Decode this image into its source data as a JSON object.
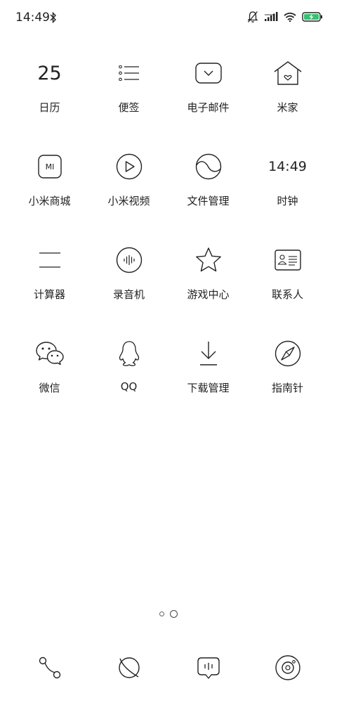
{
  "status_bar": {
    "time": "14:49",
    "icons": [
      "bluetooth-icon",
      "mute-icon",
      "signal-icon",
      "wifi-icon",
      "battery-charging-icon"
    ],
    "battery_color": "#38c172"
  },
  "calendar": {
    "day": "25"
  },
  "clock": {
    "time": "14:49"
  },
  "mi_badge": "MI",
  "apps": [
    {
      "label": "日历",
      "icon": "calendar-icon"
    },
    {
      "label": "便签",
      "icon": "notes-icon"
    },
    {
      "label": "电子邮件",
      "icon": "email-icon"
    },
    {
      "label": "米家",
      "icon": "home-icon"
    },
    {
      "label": "小米商城",
      "icon": "mi-store-icon"
    },
    {
      "label": "小米视频",
      "icon": "video-icon"
    },
    {
      "label": "文件管理",
      "icon": "file-manager-icon"
    },
    {
      "label": "时钟",
      "icon": "clock-icon"
    },
    {
      "label": "计算器",
      "icon": "calculator-icon"
    },
    {
      "label": "录音机",
      "icon": "recorder-icon"
    },
    {
      "label": "游戏中心",
      "icon": "star-icon"
    },
    {
      "label": "联系人",
      "icon": "contacts-icon"
    },
    {
      "label": "微信",
      "icon": "wechat-icon"
    },
    {
      "label": "QQ",
      "icon": "qq-icon"
    },
    {
      "label": "下载管理",
      "icon": "download-icon"
    },
    {
      "label": "指南针",
      "icon": "compass-icon"
    }
  ],
  "page_indicator": {
    "pages": 2,
    "current": 2
  },
  "dock": [
    {
      "icon": "phone-icon"
    },
    {
      "icon": "browser-icon"
    },
    {
      "icon": "messages-icon"
    },
    {
      "icon": "camera-icon"
    }
  ]
}
